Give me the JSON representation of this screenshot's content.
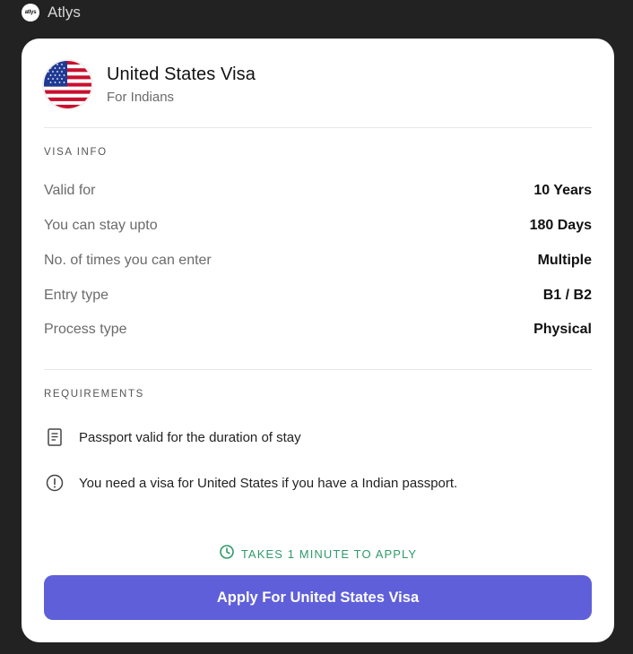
{
  "app": {
    "logo_text": "atlys",
    "name": "Atlys"
  },
  "header": {
    "title": "United States Visa",
    "subtitle": "For Indians",
    "flag_icon": "us-flag-icon"
  },
  "visa_info": {
    "section_label": "VISA INFO",
    "rows": [
      {
        "label": "Valid for",
        "value": "10 Years"
      },
      {
        "label": "You can stay upto",
        "value": "180 Days"
      },
      {
        "label": "No. of times you can enter",
        "value": "Multiple"
      },
      {
        "label": "Entry type",
        "value": "B1 / B2"
      },
      {
        "label": "Process type",
        "value": "Physical"
      }
    ]
  },
  "requirements": {
    "section_label": "REQUIREMENTS",
    "items": [
      {
        "icon": "document-icon",
        "text": "Passport valid for the duration of stay"
      },
      {
        "icon": "info-circle-icon",
        "text": "You need a visa for United States if you have a Indian passport."
      }
    ]
  },
  "footer": {
    "takes_text": "TAKES 1 MINUTE TO APPLY",
    "takes_icon": "clock-icon",
    "apply_label": "Apply For United States Visa"
  },
  "colors": {
    "background": "#222222",
    "card": "#ffffff",
    "accent": "#5f5fda",
    "success": "#2f9a6c"
  }
}
